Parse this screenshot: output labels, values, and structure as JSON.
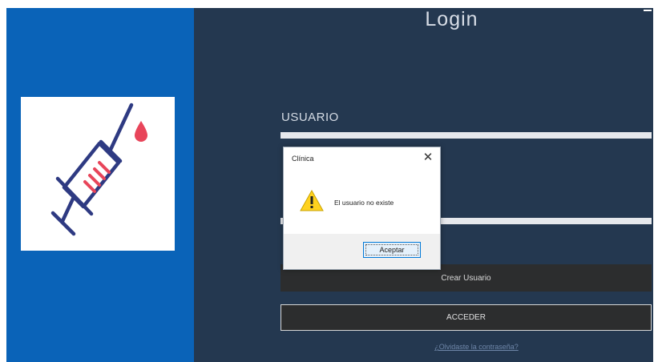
{
  "window": {
    "title": "Login"
  },
  "form": {
    "user_label": "USUARIO",
    "create_user_label": "Crear Usuario",
    "access_label": "ACCEDER",
    "forgot_link": "¿Olvidaste la contraseña?"
  },
  "dialog": {
    "title": "Clínica",
    "message": "El usuario no existe",
    "ok_label": "Aceptar",
    "icon": "warning-icon"
  },
  "colors": {
    "left_panel": "#0a63b8",
    "main_background": "#243850",
    "button_background": "#2c2d2e",
    "syringe_stroke": "#2e3a82",
    "drop_color": "#e8455a"
  }
}
